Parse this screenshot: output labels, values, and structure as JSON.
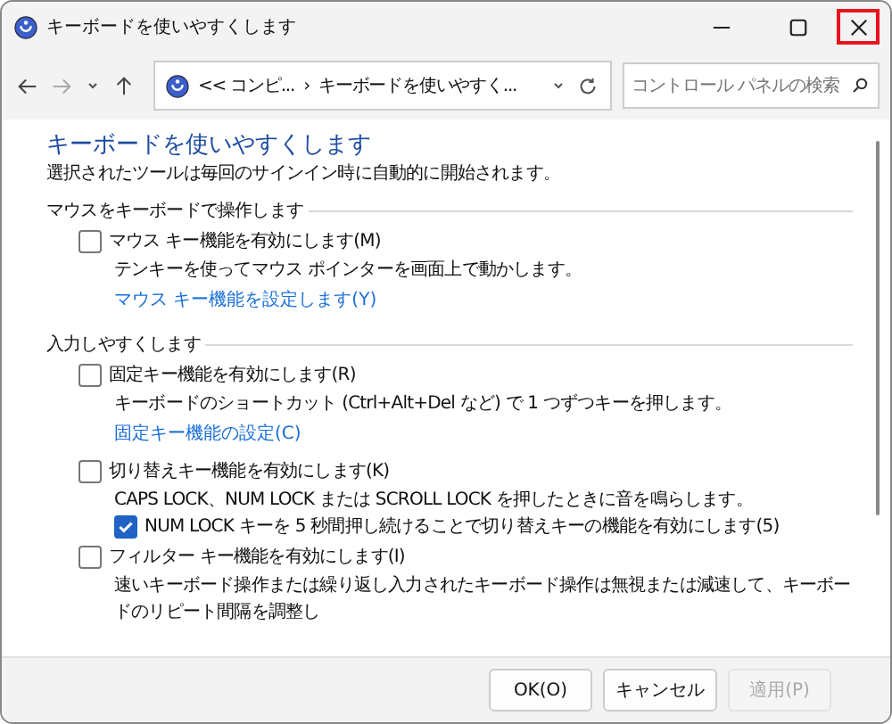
{
  "window": {
    "title": "キーボードを使いやすくします",
    "close_highlighted": true
  },
  "address_bar": {
    "path": [
      "<< コンピ...",
      "›",
      "キーボードを使いやすく..."
    ]
  },
  "search": {
    "placeholder": "コントロール パネルの検索"
  },
  "page": {
    "heading": "キーボードを使いやすくします",
    "subtitle": "選択されたツールは毎回のサインイン時に自動的に開始されます。"
  },
  "sections": [
    {
      "title": "マウスをキーボードで操作します",
      "items": [
        {
          "kind": "checkbox",
          "label": "マウス キー機能を有効にします(M)",
          "checked": false
        },
        {
          "kind": "description",
          "label": "テンキーを使ってマウス ポインターを画面上で動かします。"
        },
        {
          "kind": "link",
          "label": "マウス キー機能を設定します(Y)"
        }
      ]
    },
    {
      "title": "入力しやすくします",
      "items": [
        {
          "kind": "checkbox",
          "label": "固定キー機能を有効にします(R)",
          "checked": false
        },
        {
          "kind": "description",
          "label": "キーボードのショートカット (Ctrl+Alt+Del など) で 1 つずつキーを押します。"
        },
        {
          "kind": "link",
          "label": "固定キー機能の設定(C)"
        },
        {
          "kind": "checkbox",
          "label": "切り替えキー機能を有効にします(K)",
          "checked": false
        },
        {
          "kind": "description",
          "label": "CAPS LOCK、NUM LOCK または SCROLL LOCK を押したときに音を鳴らします。"
        },
        {
          "kind": "subcheckbox",
          "label": "NUM LOCK キーを 5 秒間押し続けることで切り替えキーの機能を有効にします(5)",
          "checked": true
        },
        {
          "kind": "checkbox",
          "label": "フィルター キー機能を有効にします(I)",
          "checked": false
        },
        {
          "kind": "description",
          "label": "速いキーボード操作または繰り返し入力されたキーボード操作は無視または減速して、キーボードのリピート間隔を調整し"
        }
      ]
    }
  ],
  "buttons": [
    {
      "label": "OK(O)",
      "disabled": false
    },
    {
      "label": "キャンセル",
      "disabled": false
    },
    {
      "label": "適用(P)",
      "disabled": true
    }
  ]
}
